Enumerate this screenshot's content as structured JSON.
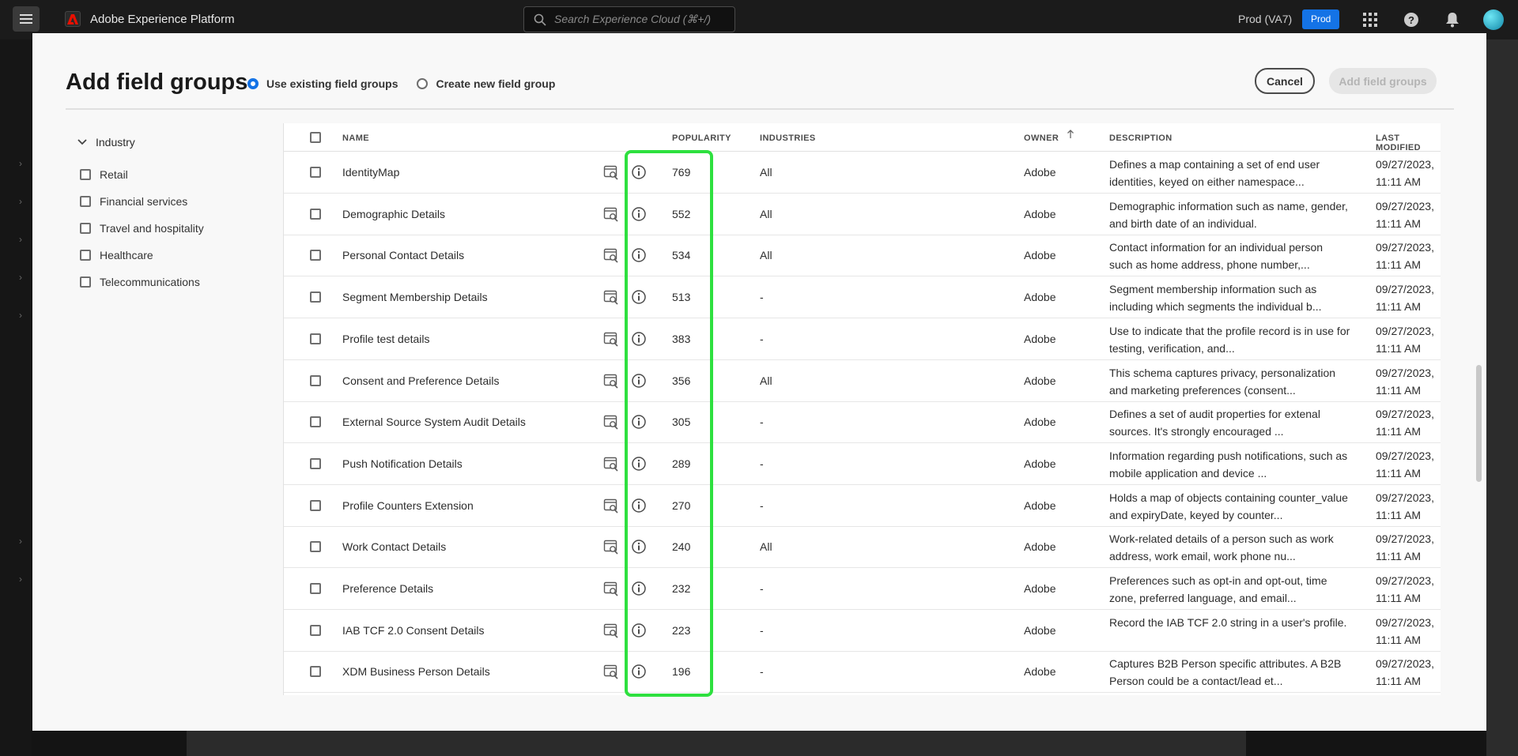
{
  "app": {
    "title": "Adobe Experience Platform",
    "search_placeholder": "Search Experience Cloud (⌘+/)",
    "org_name": "Prod (VA7)",
    "sandbox_badge": "Prod"
  },
  "modal": {
    "title": "Add field groups",
    "radio_existing": "Use existing field groups",
    "radio_new": "Create new field group",
    "cancel_label": "Cancel",
    "add_label": "Add field groups"
  },
  "filter": {
    "heading": "Industry",
    "items": [
      "Retail",
      "Financial services",
      "Travel and hospitality",
      "Healthcare",
      "Telecommunications"
    ]
  },
  "table": {
    "columns": {
      "name": "NAME",
      "popularity": "POPULARITY",
      "industries": "INDUSTRIES",
      "owner": "OWNER",
      "description": "DESCRIPTION",
      "last_modified": "LAST MODIFIED"
    },
    "rows": [
      {
        "name": "IdentityMap",
        "popularity": "769",
        "industries": "All",
        "owner": "Adobe",
        "desc1": "Defines a map containing a set of end user",
        "desc2": "identities, keyed on either namespace...",
        "date": "09/27/2023,",
        "time": "11:11 AM"
      },
      {
        "name": "Demographic Details",
        "popularity": "552",
        "industries": "All",
        "owner": "Adobe",
        "desc1": "Demographic information such as name, gender,",
        "desc2": "and birth date of an individual.",
        "date": "09/27/2023,",
        "time": "11:11 AM"
      },
      {
        "name": "Personal Contact Details",
        "popularity": "534",
        "industries": "All",
        "owner": "Adobe",
        "desc1": "Contact information for an individual person",
        "desc2": "such as home address, phone number,...",
        "date": "09/27/2023,",
        "time": "11:11 AM"
      },
      {
        "name": "Segment Membership Details",
        "popularity": "513",
        "industries": "-",
        "owner": "Adobe",
        "desc1": "Segment membership information such as",
        "desc2": "including which segments the individual b...",
        "date": "09/27/2023,",
        "time": "11:11 AM"
      },
      {
        "name": "Profile test details",
        "popularity": "383",
        "industries": "-",
        "owner": "Adobe",
        "desc1": "Use to indicate that the profile record is in use for",
        "desc2": "testing, verification, and...",
        "date": "09/27/2023,",
        "time": "11:11 AM"
      },
      {
        "name": "Consent and Preference Details",
        "popularity": "356",
        "industries": "All",
        "owner": "Adobe",
        "desc1": "This schema captures privacy, personalization",
        "desc2": "and marketing preferences (consent...",
        "date": "09/27/2023,",
        "time": "11:11 AM"
      },
      {
        "name": "External Source System Audit Details",
        "popularity": "305",
        "industries": "-",
        "owner": "Adobe",
        "desc1": "Defines a set of audit properties for extenal",
        "desc2": "sources. It's strongly encouraged ...",
        "date": "09/27/2023,",
        "time": "11:11 AM"
      },
      {
        "name": "Push Notification Details",
        "popularity": "289",
        "industries": "-",
        "owner": "Adobe",
        "desc1": "Information regarding push notifications, such as",
        "desc2": "mobile application and device ...",
        "date": "09/27/2023,",
        "time": "11:11 AM"
      },
      {
        "name": "Profile Counters Extension",
        "popularity": "270",
        "industries": "-",
        "owner": "Adobe",
        "desc1": "Holds a map of objects containing counter_value",
        "desc2": "and expiryDate, keyed by counter...",
        "date": "09/27/2023,",
        "time": "11:11 AM"
      },
      {
        "name": "Work Contact Details",
        "popularity": "240",
        "industries": "All",
        "owner": "Adobe",
        "desc1": "Work-related details of a person such as work",
        "desc2": "address, work email, work phone nu...",
        "date": "09/27/2023,",
        "time": "11:11 AM"
      },
      {
        "name": "Preference Details",
        "popularity": "232",
        "industries": "-",
        "owner": "Adobe",
        "desc1": "Preferences such as opt-in and opt-out, time",
        "desc2": "zone, preferred language, and email...",
        "date": "09/27/2023,",
        "time": "11:11 AM"
      },
      {
        "name": "IAB TCF 2.0 Consent Details",
        "popularity": "223",
        "industries": "-",
        "owner": "Adobe",
        "desc1": "Record the IAB TCF 2.0 string in a user's profile.",
        "desc2": "",
        "date": "09/27/2023,",
        "time": "11:11 AM"
      },
      {
        "name": "XDM Business Person Details",
        "popularity": "196",
        "industries": "-",
        "owner": "Adobe",
        "desc1": "Captures B2B Person specific attributes. A B2B",
        "desc2": "Person could be a contact/lead et...",
        "date": "09/27/2023,",
        "time": "11:11 AM"
      }
    ]
  },
  "colors": {
    "accent": "#1473e6",
    "highlight": "#2ee03f"
  }
}
